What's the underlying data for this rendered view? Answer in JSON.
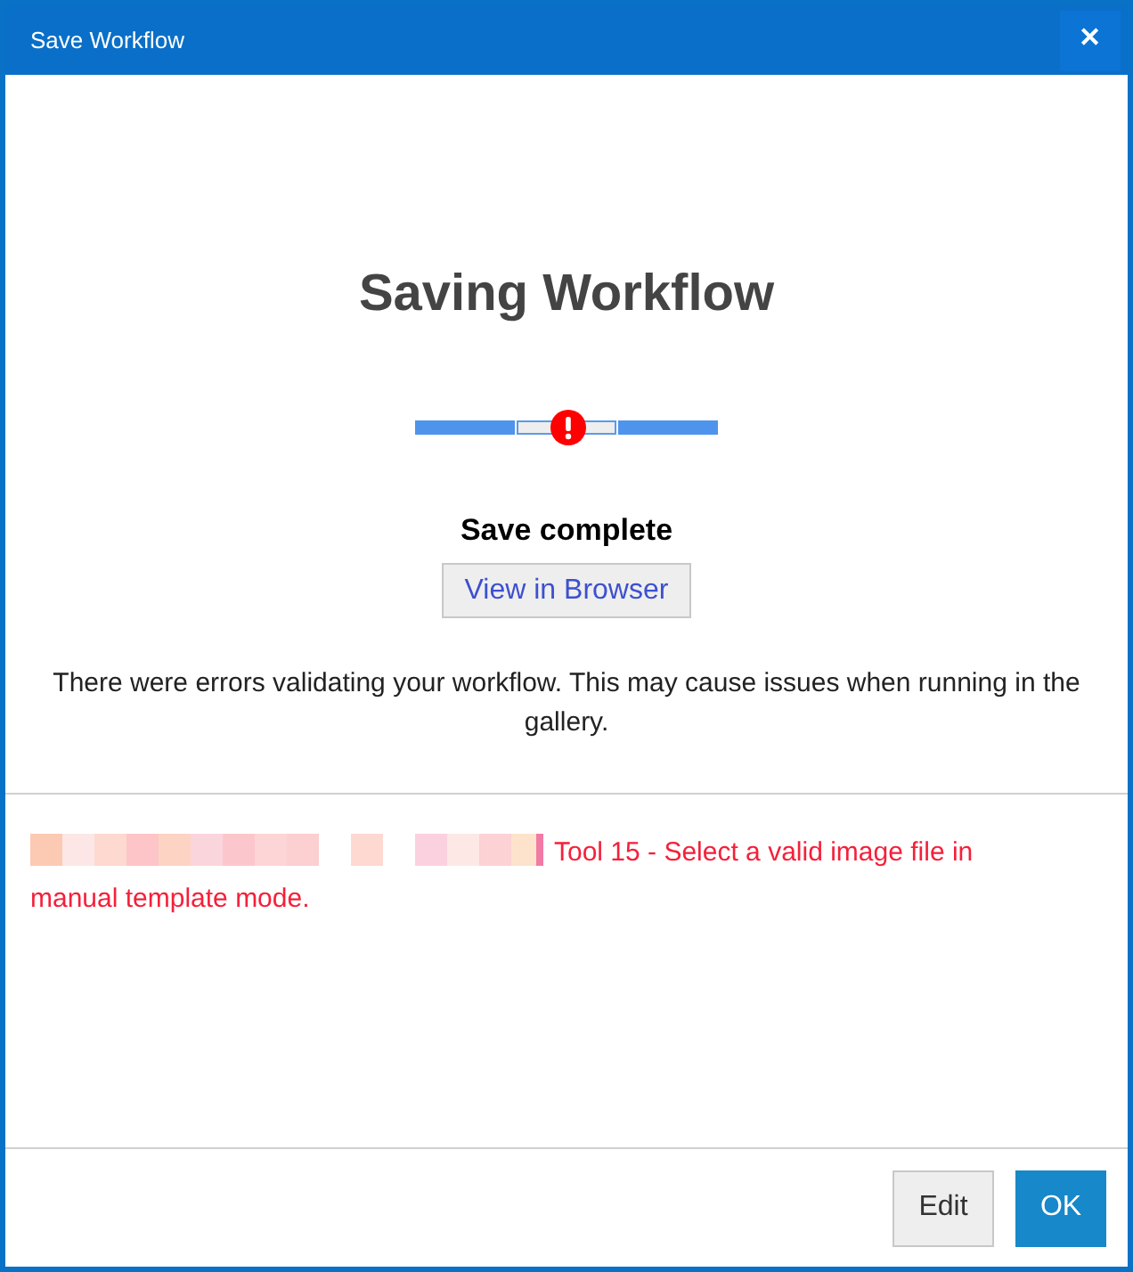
{
  "window": {
    "title": "Save Workflow",
    "close": "✕"
  },
  "heading": "Saving Workflow",
  "steps": [
    {
      "kind": "done"
    },
    {
      "kind": "error"
    },
    {
      "kind": "done"
    }
  ],
  "status": "Save complete",
  "view_button": "View in Browser",
  "message": "There were errors validating your workflow. This may cause issues when running in the gallery.",
  "errors": [
    {
      "text": "Tool 15 - Select a valid image file in manual template mode.",
      "redacted": true
    }
  ],
  "buttons": [
    {
      "label": "Edit",
      "kind": "secondary"
    },
    {
      "label": "OK",
      "kind": "primary"
    }
  ]
}
